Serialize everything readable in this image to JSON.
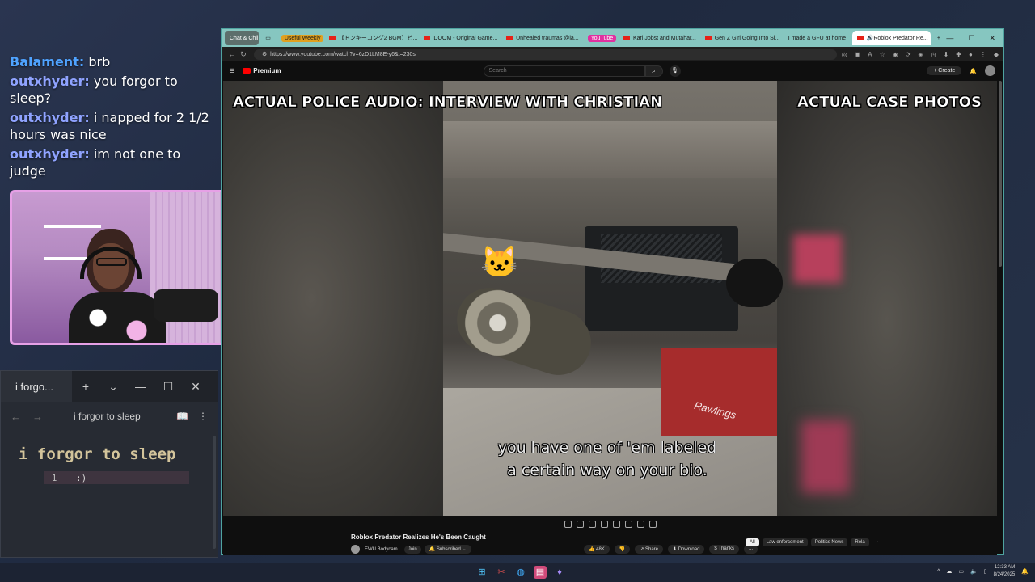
{
  "chat": [
    {
      "user": "Balament:",
      "text": "brb",
      "color": "#4fa3ff"
    },
    {
      "user": "outxhyder:",
      "text": "you forgor to sleep?",
      "color": "#8fa3ff"
    },
    {
      "user": "outxhyder:",
      "text": "i napped for 2 1/2 hours was nice",
      "color": "#8fa3ff"
    },
    {
      "user": "outxhyder:",
      "text": "im not one to judge",
      "color": "#8fa3ff"
    }
  ],
  "notepad": {
    "tab_title": "i forgo...",
    "add_tab": "+",
    "dropdown": "⌄",
    "minimize": "—",
    "maximize": "☐",
    "close": "✕",
    "back": "←",
    "forward": "→",
    "doc_title": "i forgor to sleep",
    "heading": "i forgor to sleep",
    "line_number": "1",
    "line_text": ":)"
  },
  "browser": {
    "tabs": [
      {
        "label": "Chat & Chil",
        "type": "group"
      },
      {
        "label": "Useful Weekly",
        "type": "group-label",
        "color": "#e0a020"
      },
      {
        "label": "【ドンキーコング2 BGM】ビ...",
        "type": "tab"
      },
      {
        "label": "DOOM - Original Game...",
        "type": "tab"
      },
      {
        "label": "Unhealed traumas @la...",
        "type": "tab"
      },
      {
        "label": "YouTube",
        "type": "group-label",
        "color": "#e030a0"
      },
      {
        "label": "Karl Jobst and Mutahar...",
        "type": "tab"
      },
      {
        "label": "Gen Z Girl Going Into Si...",
        "type": "tab"
      },
      {
        "label": "I made a GFU at home",
        "type": "tab"
      },
      {
        "label": "Roblox Predator Re...",
        "type": "active"
      }
    ],
    "new_tab": "+",
    "win_min": "—",
    "win_max": "☐",
    "win_close": "✕",
    "url": "https://www.youtube.com/watch?v=6zD1LM8E-y6&t=230s"
  },
  "youtube": {
    "logo": "Premium",
    "search_placeholder": "Search",
    "create": "+ Create",
    "video_title_left": "ACTUAL POLICE AUDIO: INTERVIEW WITH CHRISTIAN",
    "video_title_right": "ACTUAL CASE PHOTOS",
    "caption_line1": "you have one of 'em labeled",
    "caption_line2": "a certain way on your bio.",
    "box_label": "Rawlings",
    "title": "Roblox Predator Realizes He's Been Caught",
    "channel": "EWU Bodycam",
    "join": "Join",
    "subscribed": "🔔 Subscribed ⌄",
    "likes": "👍 48K",
    "dislike": "👎",
    "share": "↗ Share",
    "download": "⬇ Download",
    "thanks": "$ Thanks",
    "more": "...",
    "chips": [
      "All",
      "Law enforcement",
      "Politics News",
      "Rela"
    ],
    "chips_next": "›"
  },
  "taskbar": {
    "time": "12:33 AM",
    "date": "8/24/2025",
    "tray": "^"
  }
}
